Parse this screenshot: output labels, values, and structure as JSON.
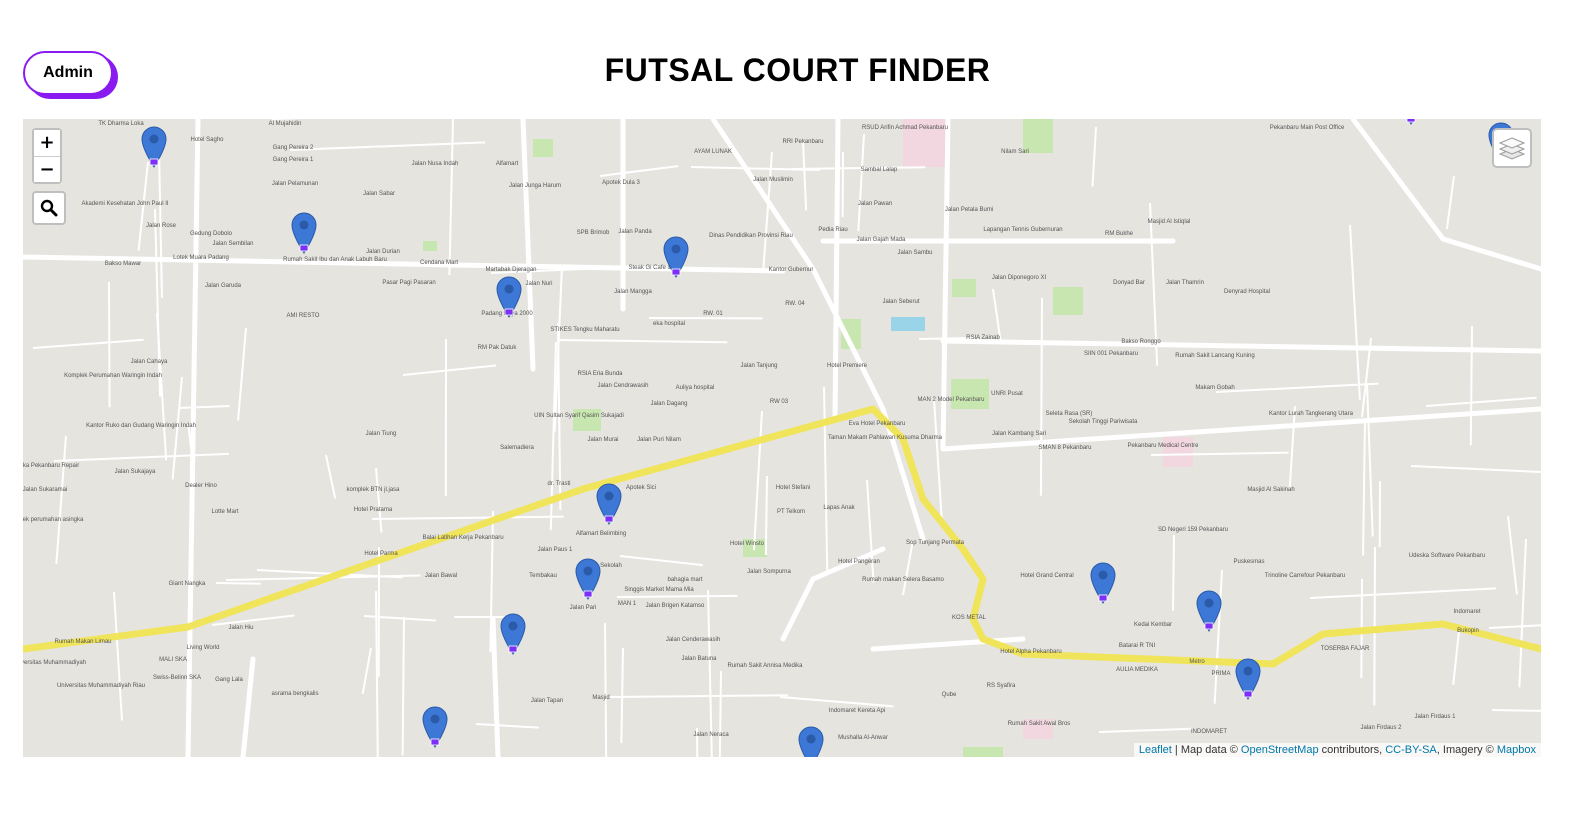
{
  "header": {
    "admin_label": "Admin",
    "title": "FUTSAL COURT FINDER"
  },
  "map": {
    "controls": {
      "zoom_in": "+",
      "zoom_out": "−",
      "search_icon": "search-icon",
      "layers_icon": "layers-icon"
    },
    "attribution": {
      "leaflet": "Leaflet",
      "sep1": " | Map data © ",
      "osm": "OpenStreetMap",
      "sep2": " contributors, ",
      "license": "CC-BY-SA",
      "sep3": ", Imagery © ",
      "imagery": "Mapbox"
    },
    "colors": {
      "background": "#e6e4df",
      "road": "#ffffff",
      "highway": "#f0e45a",
      "park": "#c8e6b0",
      "pin": "#3d78d6",
      "pin_marker": "#7b2ff7"
    },
    "marker_count": 14,
    "labels": [
      "TK Dharma Loka",
      "Al Mujahidin",
      "Hotel Sagho",
      "Gang Pereira 2",
      "Gang Pereira 1",
      "Jalan Sabar",
      "Jalan Nusa Indah",
      "Alfamart",
      "AYAM LUNAK",
      "RRI Pekanbaru",
      "RSUD Arifin Achmad Pekanbaru",
      "Nilam Sari",
      "Pekanbaru Main Post Office",
      "Jalan Pelamunan",
      "Jalan Junga Harum",
      "Apotek Dula 3",
      "Jalan Muslimin",
      "Sambal Lalap",
      "Akademi Kesehatan John Paul II",
      "Gedung Dobolo",
      "Jalan Sembilan",
      "Jalan Rose",
      "SPB Brimob",
      "Jalan Panda",
      "Jalan Pawan",
      "Jalan Petala Bumi",
      "Masjid Al Istiqlal",
      "Lapangan Tennis Gubernuran",
      "Jalan Durian",
      "Rumah Sakit Ibu dan Anak Labuh Baru",
      "Cendana Mart",
      "Martabak Djeragan",
      "Dinas Pendidikan Provinsi Riau",
      "Pedia Riau",
      "Jalan Gajah Mada",
      "RM Bukhe",
      "Bakso Mawar",
      "Lotek Muara Padang",
      "Pasar Pagi Pasaran",
      "Jalan Nuri",
      "Steak Gi Cafe & R",
      "Jalan Mangga",
      "Kantor Gubernur",
      "Jalan Sambu",
      "Jalan Diponegoro XI",
      "Donyad Bar",
      "Jalan Thamrin",
      "Denyrad Hospital",
      "Jalan Garuda",
      "AMI RESTO",
      "Padang Raya 2000",
      "RM Pak Datuk",
      "STIKES Tengku Maharatu",
      "eka hospital",
      "RW. 01",
      "RW. 04",
      "Jalan Seberut",
      "RSIA Zainab",
      "Bakso Ronggo",
      "SIIN 001 Pekanbaru",
      "Rumah Sakit Lancang Kuning",
      "Jalan Cahaya",
      "Komplek Perumahan Waringin Indah",
      "RSIA Eria Bunda",
      "Jalan Cendrawasih",
      "Auliya hospital",
      "Jalan Tanjung",
      "Hotel Premiere",
      "Makam Gobah",
      "MAN 2 Model Pekanbaru",
      "UNRI Pusat",
      "Kantor Ruko dan Gudang Waringin Indah",
      "UIN Sultan Syarif Qasim Sukajadi",
      "Jalan Dagang",
      "RW 03",
      "Seleta Rasa (SR)",
      "Sekolah Tinggi Pariwisata",
      "Kantor Lurah Tangkerang Utara",
      "Jalan Tiung",
      "Salemadiera",
      "Jalan Murai",
      "Jalan Puri Nilam",
      "Eva Hotel Pekanbaru",
      "Taman Makam Pahlawan Kusuma Dharma",
      "Jalan Kambang Sari",
      "SMAN 8 Pekanbaru",
      "Pekanbaru Medical Centre",
      "Arengka Pekanbaru Repair",
      "Jalan Sukajaya",
      "dr. Trasti",
      "Apotek Sici",
      "Hotel Stefani",
      "Masjid Al Sakinah",
      "Jalan Sukaramai",
      "Dealer Hino",
      "Lotte Mart",
      "komplek BTN jl.jasa",
      "Hotel Pratama",
      "Alfamart Belimbing",
      "Hotel Winsto",
      "PT Telkom",
      "Lapas Anak",
      "SD Negeri 159 Pekanbaru",
      "komplek perumahan asingka",
      "Hotel Parma",
      "Balai Latihan Kerja Pekanbaru",
      "Jalan Paus 1",
      "Jalan Sekolah",
      "Tembakau",
      "Singgis Market Mama Mia",
      "Jalan Sompurna",
      "Hotel Pangeran",
      "Sop Tunjang Permata",
      "Rumah makan Selera Basamo",
      "Puskesmas",
      "Udeska Software Pekanbaru",
      "Trinoline Carrefour Pekanbaru",
      "Giant Nangka",
      "Jalan Bawal",
      "bahagia mart",
      "Jalan Brigen Katamso",
      "Hotel Grand Central",
      "KOS METAL",
      "Kedai Kembar",
      "Indomaret",
      "Bukopin",
      "Jalan Hiu",
      "asrama bengkalis",
      "Jalan Pari",
      "MAN 1",
      "Jalan Cenderawasih",
      "Hotel Alpha Pekanbaru",
      "Batarai R TNI",
      "Metro",
      "TOSERBA FAJAR",
      "Rumah Makan Limau",
      "Universitas Muhammadiyah",
      "MALI SKA",
      "Living World",
      "Universitas Muhammadiyah Riau",
      "Swiss-Belinn SKA",
      "Gang Lala",
      "Jalan Batuna",
      "Rumah Sakit Annisa Medika",
      "AULIA MEDIKA",
      "PRIMA",
      "Masjid",
      "Jalan Tapan",
      "Jalan Neraca",
      "Indomaret Kereta Api",
      "Qube",
      "RS Syafira",
      "Jalan Firdaus 1",
      "Jalan Firdaus 2",
      "INDOMARET",
      "Mushalla Al-Anwar",
      "Rumah Sakit Awal Bros"
    ]
  }
}
